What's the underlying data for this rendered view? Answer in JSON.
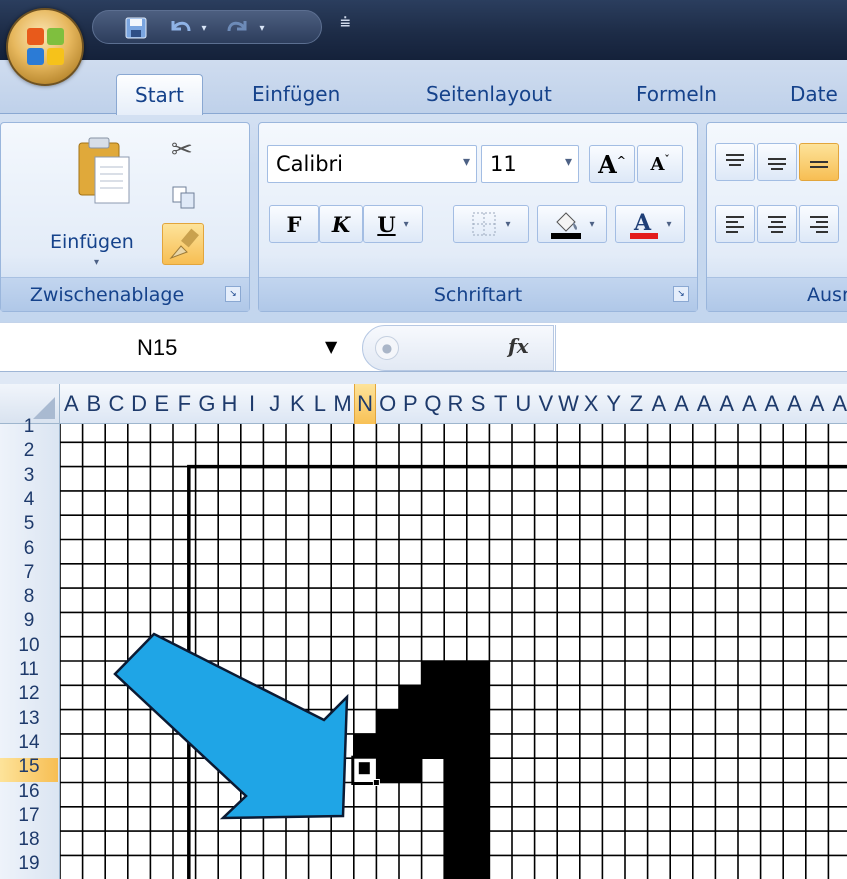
{
  "quick_access": {
    "save_icon": "save-icon",
    "undo_icon": "undo-icon",
    "redo_icon": "redo-icon",
    "customize_icon": "customize-icon"
  },
  "tabs": [
    {
      "label": "Start",
      "active": true
    },
    {
      "label": "Einfügen",
      "active": false
    },
    {
      "label": "Seitenlayout",
      "active": false
    },
    {
      "label": "Formeln",
      "active": false
    },
    {
      "label": "Date",
      "active": false
    }
  ],
  "clipboard": {
    "paste_label": "Einfügen",
    "group_label": "Zwischenablage"
  },
  "font": {
    "name": "Calibri",
    "size": "11",
    "bold_label": "F",
    "italic_label": "K",
    "underline_label": "U",
    "group_label": "Schriftart",
    "fill_color": "#000000",
    "font_color": "#e31c1c"
  },
  "alignment": {
    "group_label": "Ausr"
  },
  "formula_bar": {
    "name_box": "N15",
    "fx_label": "fx",
    "formula": ""
  },
  "sheet": {
    "columns": [
      "A",
      "B",
      "C",
      "D",
      "E",
      "F",
      "G",
      "H",
      "I",
      "J",
      "K",
      "L",
      "M",
      "N",
      "O",
      "P",
      "Q",
      "R",
      "S",
      "T",
      "U",
      "V",
      "W",
      "X",
      "Y",
      "Z",
      "A",
      "A",
      "A",
      "A",
      "A",
      "A",
      "A",
      "A",
      "A"
    ],
    "selected_column": "N",
    "rows": [
      "1",
      "2",
      "3",
      "4",
      "5",
      "6",
      "7",
      "8",
      "9",
      "10",
      "11",
      "12",
      "13",
      "14",
      "15",
      "16",
      "17",
      "18",
      "19"
    ],
    "selected_row": "15",
    "active_cell": "N15",
    "arrow_color": "#1fa5e6",
    "filled_color": "#000000"
  }
}
